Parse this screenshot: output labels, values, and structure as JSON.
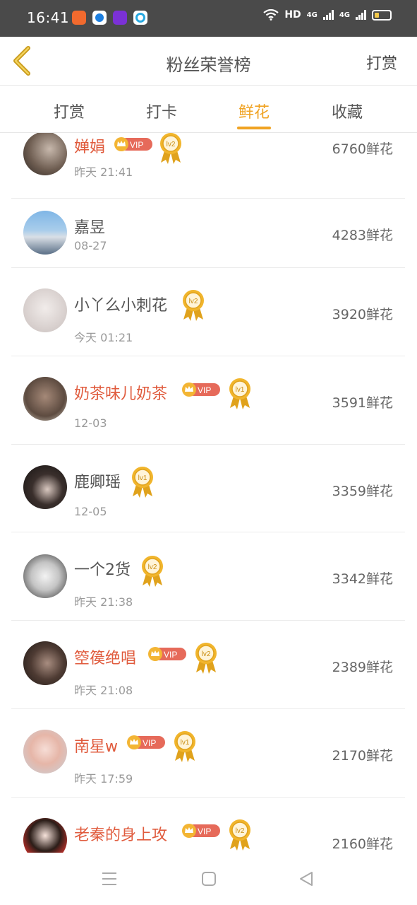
{
  "status_bar": {
    "time": "16:41",
    "network_label": "HD",
    "signal_1": "4G",
    "signal_2": "4G",
    "colors": {
      "app1": "#f26a2e",
      "app2": "#1d7fe0",
      "app3": "#7b31d6",
      "app4": "#27a8e0"
    }
  },
  "header": {
    "title": "粉丝荣誉榜",
    "right_action": "打赏",
    "back_icon": "chevron-left-icon",
    "back_color": "#c99a1a"
  },
  "tabs": [
    {
      "label": "打赏",
      "active": false
    },
    {
      "label": "打卡",
      "active": false
    },
    {
      "label": "鲜花",
      "active": true
    },
    {
      "label": "收藏",
      "active": false
    }
  ],
  "accent_color": "#f0a323",
  "vip_name_color": "#e05b3d",
  "ranking": [
    {
      "name": "婵娟",
      "vip": true,
      "vip_label": "VIP",
      "level": "lv2",
      "date": "昨天 21:41",
      "score": "6760鲜花"
    },
    {
      "name": "嘉昱",
      "vip": false,
      "level": "",
      "date": "08-27",
      "score": "4283鲜花"
    },
    {
      "name": "小丫么小刺花",
      "vip": false,
      "level": "lv2",
      "date": "今天 01:21",
      "score": "3920鲜花"
    },
    {
      "name": "奶茶味儿奶茶",
      "vip": true,
      "vip_label": "VIP",
      "level": "lv1",
      "date": "12-03",
      "score": "3591鲜花"
    },
    {
      "name": "鹿卿瑶",
      "vip": false,
      "level": "lv1",
      "date": "12-05",
      "score": "3359鲜花"
    },
    {
      "name": "一个2货",
      "vip": false,
      "level": "lv2",
      "date": "昨天 21:38",
      "score": "3342鲜花"
    },
    {
      "name": "箜篌绝唱",
      "vip": true,
      "vip_label": "VIP",
      "level": "lv2",
      "date": "昨天 21:08",
      "score": "2389鲜花"
    },
    {
      "name": "南星w",
      "vip": true,
      "vip_label": "VIP",
      "level": "lv1",
      "date": "昨天 17:59",
      "score": "2170鲜花"
    },
    {
      "name": "老秦的身上攻",
      "vip": true,
      "vip_label": "VIP",
      "level": "lv2",
      "date": "",
      "score": "2160鲜花"
    }
  ],
  "navbar": {
    "icons": [
      "menu-icon",
      "home-square-icon",
      "back-triangle-icon"
    ]
  }
}
